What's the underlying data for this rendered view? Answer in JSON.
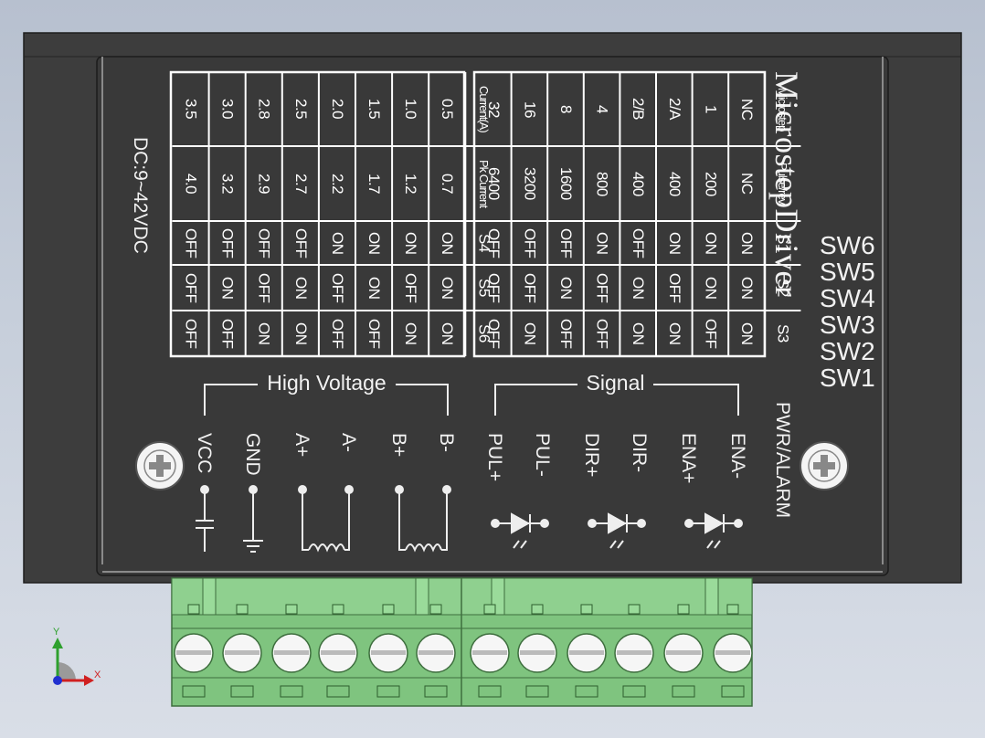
{
  "title": "MicrostepDriver",
  "power_label": "DC:9~42VDC",
  "pwr_alarm_label": "PWR/ALARM",
  "switch_labels": [
    "SW6",
    "SW5",
    "SW4",
    "SW3",
    "SW2",
    "SW1"
  ],
  "left_table": {
    "columns": [
      [
        "Current(A)",
        "Pk Current",
        "S4",
        "S5",
        "S6"
      ],
      [
        "0.5",
        "0.7",
        "ON",
        "ON",
        "ON"
      ],
      [
        "1.0",
        "1.2",
        "ON",
        "OFF",
        "ON"
      ],
      [
        "1.5",
        "1.7",
        "ON",
        "ON",
        "OFF"
      ],
      [
        "2.0",
        "2.2",
        "ON",
        "OFF",
        "OFF"
      ],
      [
        "2.5",
        "2.7",
        "OFF",
        "ON",
        "ON"
      ],
      [
        "2.8",
        "2.9",
        "OFF",
        "OFF",
        "ON"
      ],
      [
        "3.0",
        "3.2",
        "OFF",
        "ON",
        "OFF"
      ],
      [
        "3.5",
        "4.0",
        "OFF",
        "OFF",
        "OFF"
      ]
    ]
  },
  "right_table": {
    "columns": [
      [
        "Microstep",
        "Pulse/rev",
        "S1",
        "S2",
        "S3"
      ],
      [
        "NC",
        "NC",
        "ON",
        "ON",
        "ON"
      ],
      [
        "1",
        "200",
        "ON",
        "ON",
        "OFF"
      ],
      [
        "2/A",
        "400",
        "ON",
        "OFF",
        "ON"
      ],
      [
        "2/B",
        "400",
        "OFF",
        "ON",
        "ON"
      ],
      [
        "4",
        "800",
        "ON",
        "OFF",
        "OFF"
      ],
      [
        "8",
        "1600",
        "OFF",
        "ON",
        "OFF"
      ],
      [
        "16",
        "3200",
        "OFF",
        "OFF",
        "ON"
      ],
      [
        "32",
        "6400",
        "OFF",
        "OFF",
        "OFF"
      ]
    ]
  },
  "groups": {
    "high_voltage": "High Voltage",
    "signal": "Signal"
  },
  "terminals": [
    "VCC",
    "GND",
    "A+",
    "A-",
    "B+",
    "B-",
    "PUL+",
    "PUL-",
    "DIR+",
    "DIR-",
    "ENA+",
    "ENA-"
  ],
  "axes": {
    "x": "X",
    "y": "Y"
  },
  "colors": {
    "panel": "#3a3a3a",
    "panel_edge": "#2a2a2a",
    "connector": "#7fc47f",
    "connector_dark": "#4e8f4e",
    "text": "#f2f2f2"
  }
}
